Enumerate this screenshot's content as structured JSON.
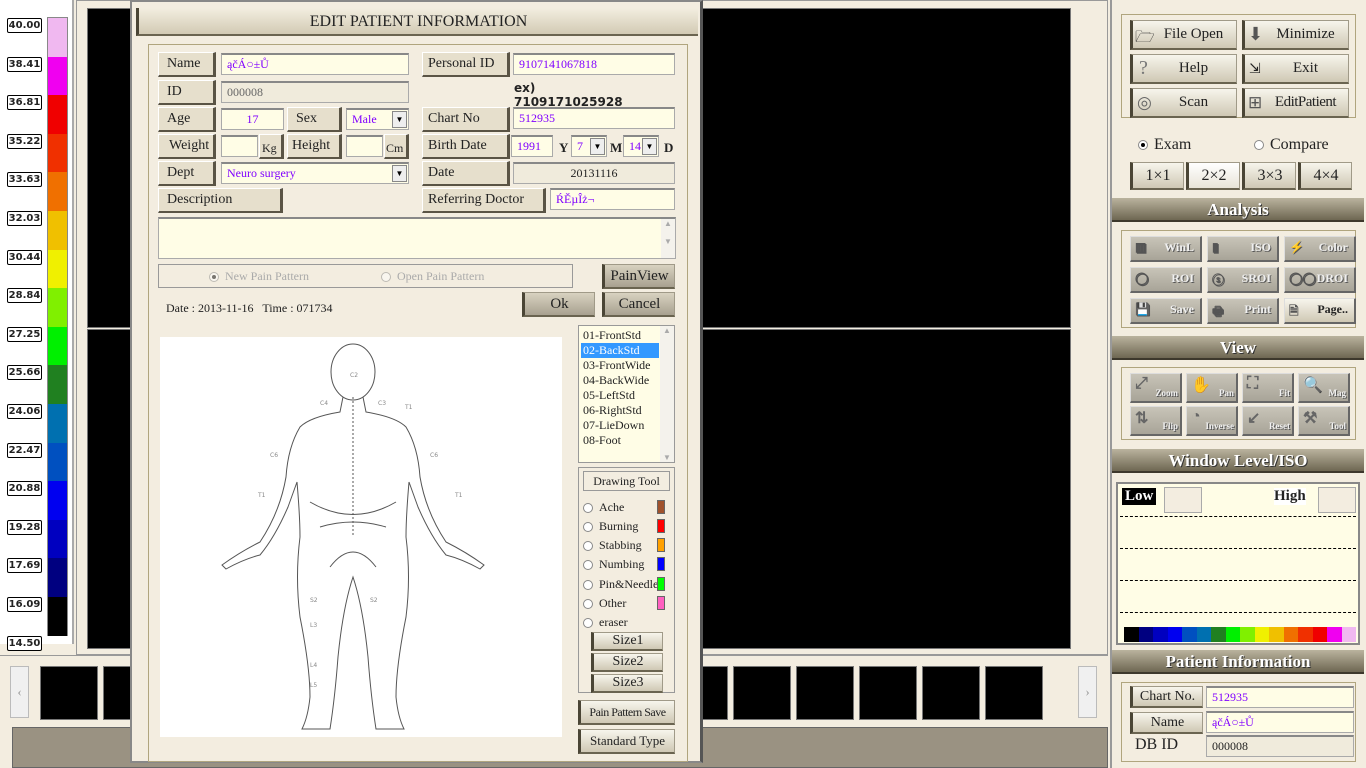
{
  "scale": {
    "labels": [
      "40.00",
      "38.41",
      "36.81",
      "35.22",
      "33.63",
      "32.03",
      "30.44",
      "28.84",
      "27.25",
      "25.66",
      "24.06",
      "22.47",
      "20.88",
      "19.28",
      "17.69",
      "16.09",
      "14.50"
    ],
    "colors": [
      "#f0b8f0",
      "#f000f0",
      "#f00000",
      "#f03000",
      "#f07000",
      "#f0c000",
      "#f0f000",
      "#80f000",
      "#00f000",
      "#208020",
      "#0070b0",
      "#0050c0",
      "#0000f0",
      "#0000c0",
      "#000080",
      "#000000"
    ]
  },
  "dialog": {
    "title": "EDIT PATIENT INFORMATION",
    "name_label": "Name",
    "name_value": "ąčÁ○±Ů",
    "id_label": "ID",
    "id_value": "000008",
    "age_label": "Age",
    "age_value": "17",
    "sex_label": "Sex",
    "sex_value": "Male",
    "weight_label": "Weight",
    "weight_unit": "Kg",
    "height_label": "Height",
    "height_unit": "Cm",
    "dept_label": "Dept",
    "dept_value": "Neuro surgery",
    "description_label": "Description",
    "personal_id_label": "Personal ID",
    "personal_id_value": "9107141067818",
    "personal_id_example": "ex) 7109171025928",
    "chart_no_label": "Chart No",
    "chart_no_value": "512935",
    "birth_date_label": "Birth Date",
    "birth_year": "1991",
    "year_unit": "Y",
    "birth_month": "7",
    "month_unit": "M",
    "birth_day": "14",
    "day_unit": "D",
    "date_label": "Date",
    "date_value": "20131116",
    "referring_doctor_label": "Referring Doctor",
    "referring_doctor_value": "ŔĚµÎż¬",
    "new_pain_pattern": "New Pain Pattern",
    "open_pain_pattern": "Open Pain Pattern",
    "painview": "PainView",
    "ok": "Ok",
    "cancel": "Cancel",
    "datetime": "Date : 2013-11-16   Time : 071734",
    "body_types": [
      "01-FrontStd",
      "02-BackStd",
      "03-FrontWide",
      "04-BackWide",
      "05-LeftStd",
      "06-RightStd",
      "07-LieDown",
      "08-Foot"
    ],
    "selected_body_type": "02-BackStd",
    "drawing_tool_title": "Drawing Tool",
    "tools": [
      {
        "label": "Ache",
        "color": "#a0522d"
      },
      {
        "label": "Burning",
        "color": "#ff0000"
      },
      {
        "label": "Stabbing",
        "color": "#ffa000"
      },
      {
        "label": "Numbing",
        "color": "#0000ff"
      },
      {
        "label": "Pin&Needle",
        "color": "#00ff00"
      },
      {
        "label": "Other",
        "color": "#ff60c0"
      },
      {
        "label": "eraser"
      }
    ],
    "sizes": [
      "Size1",
      "Size2",
      "Size3"
    ],
    "pain_pattern_save": "Pain Pattern Save",
    "standard_type": "Standard Type"
  },
  "right": {
    "file_open": "File Open",
    "minimize": "Minimize",
    "help": "Help",
    "exit": "Exit",
    "scan": "Scan",
    "edit_patient": "EditPatient",
    "exam": "Exam",
    "compare": "Compare",
    "layouts": [
      "1×1",
      "2×2",
      "3×3",
      "4×4"
    ],
    "selected_layout": "2×2",
    "analysis_title": "Analysis",
    "analysis": [
      "WinL",
      "ISO",
      "Color",
      "ROI",
      "SROI",
      "DROI",
      "Save",
      "Print",
      "Page.."
    ],
    "view_title": "View",
    "view": [
      "Zoom",
      "Pan",
      "Fit",
      "Mag",
      "Flip",
      "Inverse",
      "Reset",
      "Tool"
    ],
    "wl_title": "Window Level/ISO",
    "low": "Low",
    "high": "High",
    "pi_title": "Patient Information",
    "chart_no_label": "Chart No.",
    "chart_no": "512935",
    "name_label": "Name",
    "name": "ąčÁ○±Ů",
    "dbid_label": "DB ID",
    "dbid": "000008"
  }
}
